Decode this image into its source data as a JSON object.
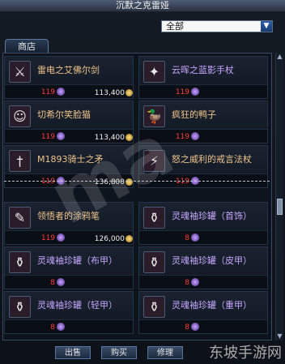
{
  "window": {
    "title": "沉默之克雷娅"
  },
  "filter": {
    "selected": "全部"
  },
  "tabs": [
    {
      "label": "商店"
    }
  ],
  "items": [
    {
      "name": "雷电之艾佛尔剑",
      "qty": "119",
      "price": "113,400",
      "icon": "sword"
    },
    {
      "name": "云晖之蓝影手杖",
      "qty": "119",
      "price": "",
      "icon": "staff"
    },
    {
      "name": "切希尔笑脸猫",
      "qty": "119",
      "price": "113,400",
      "icon": "cat"
    },
    {
      "name": "疯狂的鸭子",
      "qty": "119",
      "price": "",
      "icon": "duck"
    },
    {
      "name": "M1893骑士之矛",
      "qty": "119",
      "price": "136,800",
      "icon": "spear"
    },
    {
      "name": "怒之威利的戒言法杖",
      "qty": "119",
      "price": "",
      "icon": "staff-red"
    },
    {
      "name": "领悟者的涂鸦笔",
      "qty": "119",
      "price": "126,000",
      "icon": "pen"
    },
    {
      "name": "灵魂袖珍罐（首饰）",
      "qty": "8",
      "price": "",
      "icon": "jar"
    },
    {
      "name": "灵魂袖珍罐（布甲）",
      "qty": "8",
      "price": "",
      "icon": "jar"
    },
    {
      "name": "灵魂袖珍罐（皮甲）",
      "qty": "8",
      "price": "",
      "icon": "jar"
    },
    {
      "name": "灵魂袖珍罐（轻甲）",
      "qty": "8",
      "price": "",
      "icon": "jar"
    },
    {
      "name": "灵魂袖珍罐（重甲）",
      "qty": "8",
      "price": "",
      "icon": "jar"
    }
  ],
  "buttons": {
    "sell": "出售",
    "buy": "购买",
    "repair": "修理"
  },
  "watermark": "ma",
  "site_watermark": "东坡手游网"
}
